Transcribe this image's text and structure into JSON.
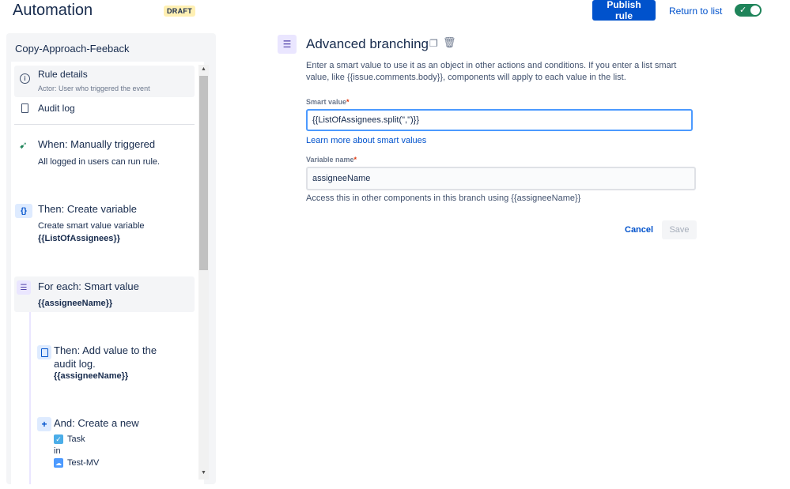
{
  "header": {
    "title": "Automation",
    "badge": "DRAFT",
    "publish_label": "Publish rule",
    "return_label": "Return to list",
    "toggle_on": true
  },
  "sidebar": {
    "rule_name": "Copy-Approach-Feeback",
    "rule_details": {
      "icon": "info-icon",
      "title": "Rule details",
      "subtitle": "Actor: User who triggered the event"
    },
    "audit_log": {
      "icon": "document-icon",
      "title": "Audit log"
    },
    "trigger": {
      "icon": "cursor-icon",
      "title": "When: Manually triggered",
      "subtitle": "All logged in users can run rule."
    },
    "create_variable": {
      "icon_text": "{}",
      "title": "Then: Create variable",
      "subtitle": "Create smart value variable",
      "value": "{{ListOfAssignees}}"
    },
    "for_each": {
      "icon": "list-icon",
      "title": "For each: Smart value",
      "value": "{{assigneeName}}"
    },
    "add_audit": {
      "icon": "document-icon",
      "title_line1": "Then: Add value to the",
      "title_line2": "audit log.",
      "value": "{{assigneeName}}"
    },
    "create_new": {
      "icon_text": "+",
      "title": "And: Create a new",
      "issue_type": "Task",
      "in_label": "in",
      "project": "Test-MV"
    }
  },
  "main": {
    "title": "Advanced branching",
    "description": "Enter a smart value to use it as an object in other actions and conditions. If you enter a list smart value, like {{issue.comments.body}}, components will apply to each value in the list.",
    "smart_value_label": "Smart value",
    "smart_value": "{{ListOfAssignees.split(\",\")}}",
    "learn_more": "Learn more about smart values",
    "variable_name_label": "Variable name",
    "variable_name": "assigneeName",
    "access_note": "Access this in other components in this branch using {{assigneeName}}",
    "required_mark": "*",
    "cancel_label": "Cancel",
    "save_label": "Save"
  },
  "colors": {
    "primary": "#0052cc",
    "toggle": "#1f845a",
    "draft_badge": "#fff0b3",
    "branch_icon_bg": "#eae6ff",
    "focus_border": "#4c9aff"
  }
}
